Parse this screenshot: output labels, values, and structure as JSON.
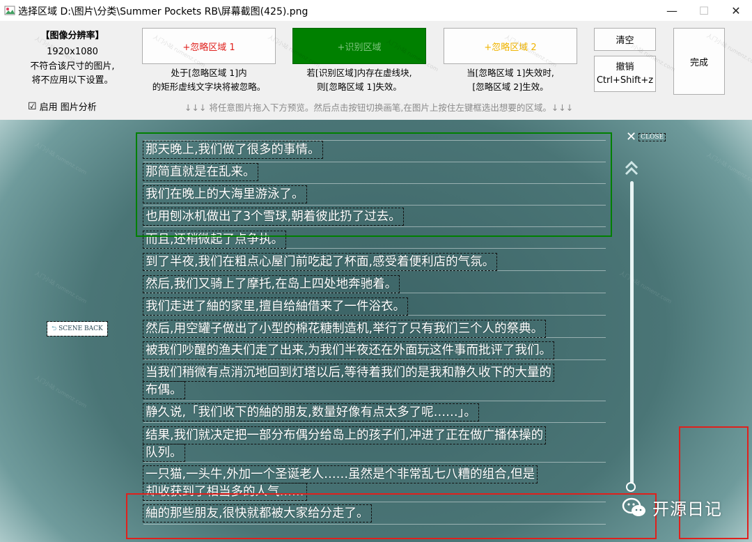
{
  "window": {
    "title": "选择区域 D:\\图片\\分类\\Summer Pockets RB\\屏幕截图(425).png",
    "minimize": "—",
    "maximize": "☐",
    "close": "✕"
  },
  "resolution": {
    "header": "【图像分辨率】",
    "value": "1920x1080",
    "note1": "不符合该尺寸的图片,",
    "note2": "将不应用以下设置。"
  },
  "buttons": {
    "ignore1": {
      "label": "+忽略区域 1",
      "text_color": "#e0201c"
    },
    "recognize": {
      "label": "+识别区域",
      "bg_color": "#008000"
    },
    "ignore2": {
      "label": "+忽略区域 2",
      "text_color": "#f0b400"
    },
    "clear": "清空",
    "undo_line1": "撤销",
    "undo_line2": "Ctrl+Shift+z",
    "done": "完成"
  },
  "descriptions": {
    "ignore1_line1": "处于[忽略区域 1]内",
    "ignore1_line2": "的矩形虚线文字块将被忽略。",
    "recognize_line1": "若[识别区域]内存在虚线块,",
    "recognize_line2": "则[忽略区域 1]失效。",
    "ignore2_line1": "当[忽略区域 1]失效时,",
    "ignore2_line2": "[忽略区域 2]生效。"
  },
  "analysis": {
    "checkbox": "☑",
    "label": "启用 图片分析",
    "checked": true
  },
  "hint": "↓↓↓ 将任意图片拖入下方预览。然后点击按钮切换画笔,在图片上按住左键框选出想要的区域。↓↓↓",
  "game": {
    "close": "CLOSE",
    "scene_back": "SCENE BACK",
    "lines": [
      "那天晚上,我们做了很多的事情。",
      "那简直就是在乱来。",
      "我们在晚上的大海里游泳了。",
      "也用刨冰机做出了3个雪球,朝着彼此扔了过去。",
      "而且,还稍微起了点争执。",
      "到了半夜,我们在粗点心屋门前吃起了杯面,感受着便利店的气氛。",
      "然后,我们又骑上了摩托,在岛上四处地奔驰着。",
      "我们走进了紬的家里,擅自给紬借来了一件浴衣。",
      "然后,用空罐子做出了小型的棉花糖制造机,举行了只有我们三个人的祭典。",
      "被我们吵醒的渔夫们走了出来,为我们半夜还在外面玩这件事而批评了我们。",
      "当我们稍微有点消沉地回到灯塔以后,等待着我们的是我和静久收下的大量的",
      "布偶。",
      "静久说,「我们收下的紬的朋友,数量好像有点太多了呢……」。",
      "结果,我们就决定把一部分布偶分给岛上的孩子们,冲进了正在做广播体操的",
      "队列。",
      "一只猫,一头牛,外加一个圣诞老人……虽然是个非常乱七八糟的组合,但是",
      "却收获到了相当多的人气……",
      "紬的那些朋友,很快就都被大家给分走了。"
    ]
  },
  "watermark": "开源日记",
  "watermark_small": "人门小站 rumenz.com",
  "colors": {
    "recognize_region": "#008000",
    "ignore_region": "#e0201c"
  }
}
